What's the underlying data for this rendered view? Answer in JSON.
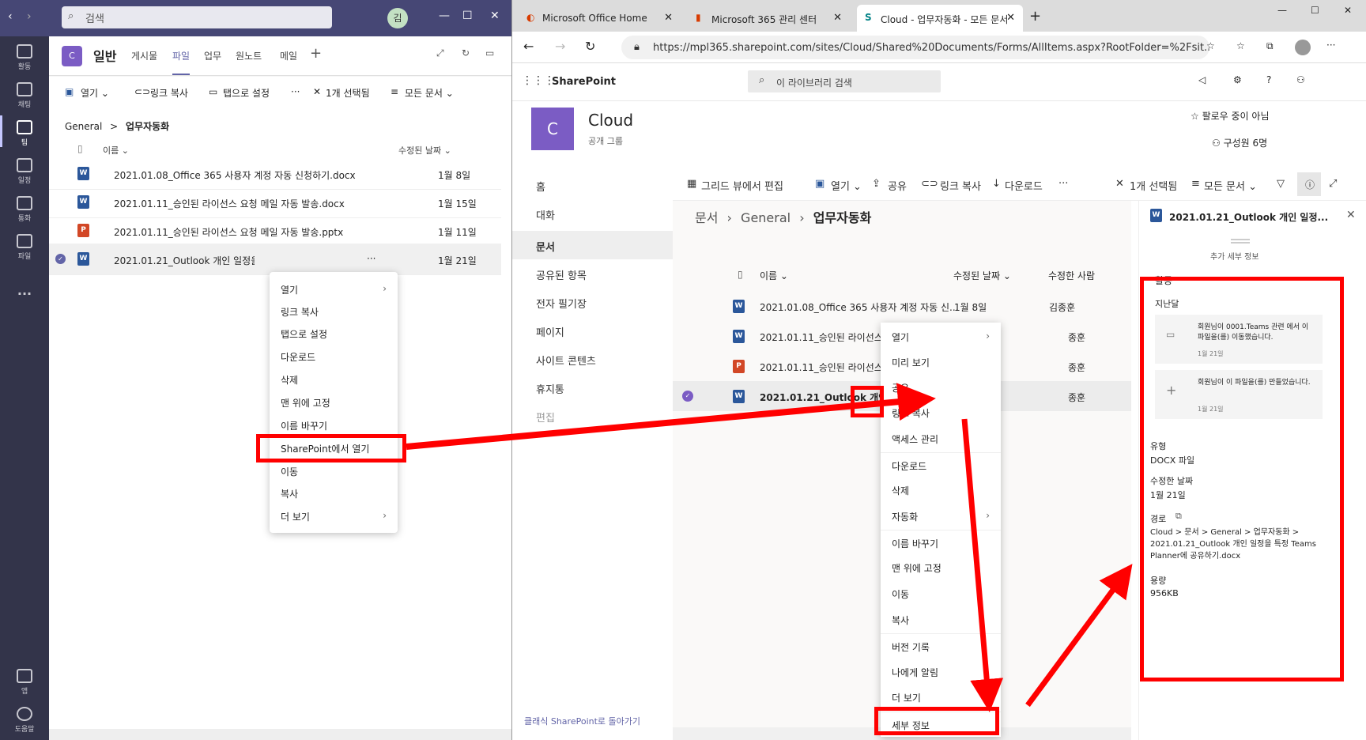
{
  "teams": {
    "search_placeholder": "검색",
    "avatar_initial": "김",
    "rail": [
      {
        "label": "활동"
      },
      {
        "label": "채팅"
      },
      {
        "label": "팀"
      },
      {
        "label": "일정"
      },
      {
        "label": "통화"
      },
      {
        "label": "파일"
      },
      {
        "label": "..."
      }
    ],
    "rail_bottom": [
      {
        "label": "앱"
      },
      {
        "label": "도움말"
      }
    ],
    "channel_avatar": "C",
    "channel_name": "일반",
    "tabs": [
      "게시물",
      "파일",
      "업무",
      "원노트",
      "메일"
    ],
    "add_tab": "+",
    "toolbar": {
      "open": "열기",
      "copy_link": "링크 복사",
      "set_tab": "탭으로 설정",
      "more": "···",
      "selected": "1개 선택됨",
      "all_docs": "모든 문서"
    },
    "breadcrumb": {
      "root": "General",
      "sep": ">",
      "current": "업무자동화"
    },
    "col_name": "이름",
    "col_modified": "수정된 날짜",
    "files": [
      {
        "name": "2021.01.08_Office 365 사용자 계정 자동 신청하기.docx",
        "date": "1월 8일",
        "type": "word"
      },
      {
        "name": "2021.01.11_승인된 라이선스 요청 메일 자동 발송.docx",
        "date": "1월 15일",
        "type": "word"
      },
      {
        "name": "2021.01.11_승인된 라이선스 요청 메일 자동 발송.pptx",
        "date": "1월 11일",
        "type": "ppt"
      },
      {
        "name": "2021.01.21_Outlook 개인 일정을 특",
        "date": "1월 21일",
        "type": "word"
      }
    ],
    "row_more": "···",
    "context_menu": [
      "열기",
      "링크 복사",
      "탭으로 설정",
      "다운로드",
      "삭제",
      "맨 위에 고정",
      "이름 바꾸기",
      "SharePoint에서 열기",
      "이동",
      "복사",
      "더 보기"
    ]
  },
  "browser": {
    "tabs": [
      {
        "title": "Microsoft Office Home"
      },
      {
        "title": "Microsoft 365 관리 센터"
      },
      {
        "title": "Cloud - 업무자동화 - 모든 문서"
      }
    ],
    "new_tab": "+",
    "url": "https://mpl365.sharepoint.com/sites/Cloud/Shared%20Documents/Forms/AllItems.aspx?RootFolder=%2Fsit..."
  },
  "sharepoint": {
    "brand": "SharePoint",
    "search_placeholder": "이 라이브러리 검색",
    "site_initial": "C",
    "site_name": "Cloud",
    "site_sub": "공개 그룹",
    "follow": "팔로우 중이 아님",
    "members": "구성원 6명",
    "nav": [
      "홈",
      "대화",
      "문서",
      "공유된 항목",
      "전자 필기장",
      "페이지",
      "사이트 콘텐츠",
      "휴지통",
      "편집"
    ],
    "nav_active": 2,
    "classic": "클래식 SharePoint로 돌아가기",
    "cmd": {
      "grid": "그리드 뷰에서 편집",
      "open": "열기",
      "share": "공유",
      "copy_link": "링크 복사",
      "download": "다운로드",
      "more": "···",
      "selected": "1개 선택됨",
      "all_docs": "모든 문서"
    },
    "breadcrumb": [
      "문서",
      "General",
      "업무자동화"
    ],
    "col_name": "이름",
    "col_modified": "수정된 날짜",
    "col_modifier": "수정한 사람",
    "files": [
      {
        "name": "2021.01.08_Office 365 사용자 계정 자동 신...",
        "date": "1월 8일",
        "by": "김종훈",
        "type": "word"
      },
      {
        "name": "2021.01.11_승인된 라이선스 요청 메일 자동...",
        "date": "",
        "by": "종훈",
        "type": "word"
      },
      {
        "name": "2021.01.11_승인된 라이선스 요청 메일 자동...",
        "date": "",
        "by": "종훈",
        "type": "ppt"
      },
      {
        "name": "2021.01.21_Outlook 개인 일정...",
        "date": "",
        "by": "종훈",
        "type": "word"
      }
    ],
    "row_more": "⋮",
    "context_menu": [
      "열기",
      "미리 보기",
      "공유",
      "링크 복사",
      "액세스 관리",
      "다운로드",
      "삭제",
      "자동화",
      "이름 바꾸기",
      "맨 위에 고정",
      "이동",
      "복사",
      "버전 기록",
      "나에게 알림",
      "더 보기",
      "세부 정보"
    ],
    "details": {
      "title": "2021.01.21_Outlook 개인 일정...",
      "more_info": "추가 세부 정보",
      "activity": "활동",
      "last_month": "지난달",
      "act1": "회원님이 0001.Teams 관련 에서 이 파일을(를) 이동했습니다.",
      "act1_link": "0001.Teams 관련",
      "act1_date": "1월 21일",
      "act2": "회원님이 이 파일을(를) 만들었습니다.",
      "act2_date": "1월 21일",
      "type_label": "유형",
      "type_value": "DOCX 파일",
      "modified_label": "수정한 날짜",
      "modified_value": "1월 21일",
      "path_label": "경로",
      "path_value": "Cloud > 문서 > General > 업무자동화 > 2021.01.21_Outlook 개인 일정을 특정 Teams Planner에 공유하기.docx",
      "size_label": "용량",
      "size_value": "956KB"
    }
  },
  "colors": {
    "teams_purple": "#464775",
    "rail": "#33344a",
    "sp_purple": "#7b5cc4",
    "highlight": "#ff0000"
  }
}
